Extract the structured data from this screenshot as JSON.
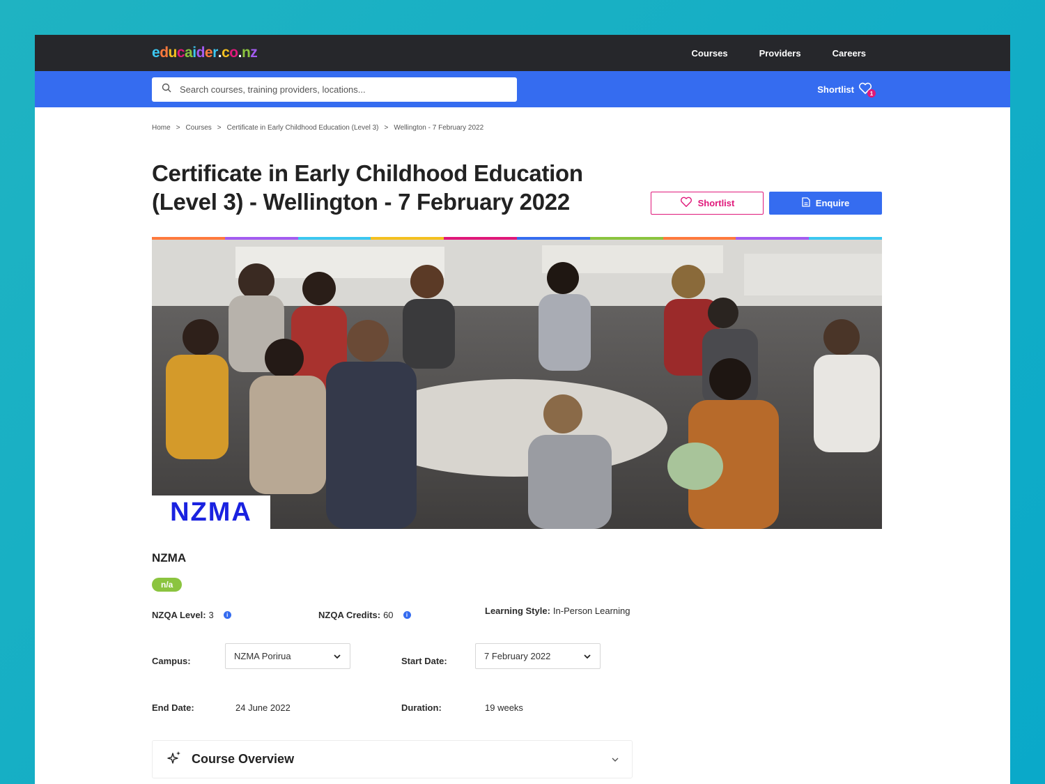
{
  "header": {
    "logo": "educaider.co.nz",
    "nav": [
      "Courses",
      "Providers",
      "Careers"
    ]
  },
  "search": {
    "placeholder": "Search courses, training providers, locations...",
    "shortlist_label": "Shortlist",
    "shortlist_count": "1"
  },
  "breadcrumb": [
    "Home",
    "Courses",
    "Certificate in Early Childhood Education (Level 3)",
    "Wellington - 7 February 2022"
  ],
  "breadcrumb_sep": ">",
  "title_line1": "Certificate in Early Childhood Education",
  "title_line2": "(Level 3) - Wellington - 7 February 2022",
  "actions": {
    "shortlist": "Shortlist",
    "enquire": "Enquire"
  },
  "hero": {
    "logo_text": "NZMA"
  },
  "provider": "NZMA",
  "rating_pill": "n/a",
  "facts": {
    "nzqa_level_label": "NZQA Level:",
    "nzqa_level": "3",
    "nzqa_credits_label": "NZQA Credits:",
    "nzqa_credits": "60",
    "learning_style_label": "Learning Style:",
    "learning_style": "In-Person Learning",
    "campus_label": "Campus:",
    "campus": "NZMA Porirua",
    "start_label": "Start Date:",
    "start": "7 February 2022",
    "end_label": "End Date:",
    "end": "24 June 2022",
    "duration_label": "Duration:",
    "duration": "19 weeks"
  },
  "overview_label": "Course Overview",
  "colors": {
    "nav_bg": "#26272b",
    "search_bg": "#356cf0",
    "accent_pink": "#e0187a",
    "pill_green": "#8bc43f"
  }
}
